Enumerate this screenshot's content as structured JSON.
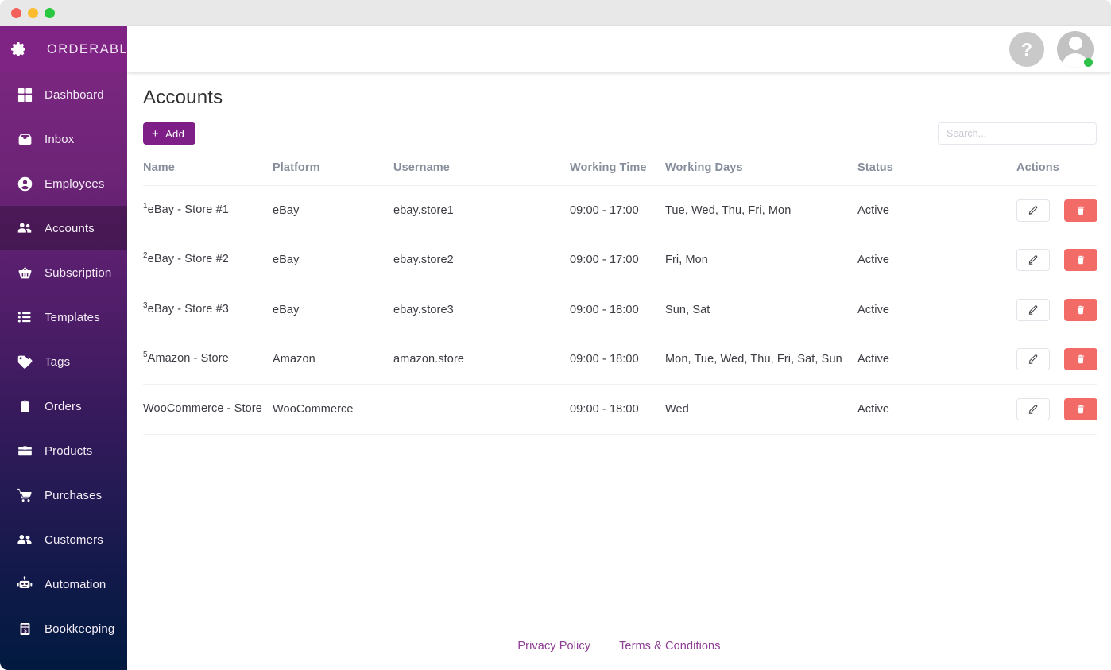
{
  "window": {
    "controls": [
      "close",
      "minimize",
      "maximize"
    ]
  },
  "brand": {
    "name": "ORDERABLY",
    "icon": "gear-icon"
  },
  "sidebar": {
    "items": [
      {
        "label": "Dashboard",
        "icon": "grid-icon",
        "active": false
      },
      {
        "label": "Inbox",
        "icon": "inbox-icon",
        "active": false
      },
      {
        "label": "Employees",
        "icon": "user-circle-icon",
        "active": false
      },
      {
        "label": "Accounts",
        "icon": "users-icon",
        "active": true
      },
      {
        "label": "Subscription",
        "icon": "basket-icon",
        "active": false
      },
      {
        "label": "Templates",
        "icon": "list-icon",
        "active": false
      },
      {
        "label": "Tags",
        "icon": "tag-icon",
        "active": false
      },
      {
        "label": "Orders",
        "icon": "clipboard-icon",
        "active": false
      },
      {
        "label": "Products",
        "icon": "box-icon",
        "active": false
      },
      {
        "label": "Purchases",
        "icon": "cart-icon",
        "active": false
      },
      {
        "label": "Customers",
        "icon": "people-icon",
        "active": false
      },
      {
        "label": "Automation",
        "icon": "robot-icon",
        "active": false
      },
      {
        "label": "Bookkeeping",
        "icon": "ledger-icon",
        "active": false
      }
    ]
  },
  "header": {
    "help_label": "?",
    "help_icon": "question-mark-icon",
    "avatar_icon": "avatar-icon",
    "status": "online"
  },
  "main": {
    "title": "Accounts",
    "add_button": {
      "label": "Add",
      "plus": "+"
    },
    "search": {
      "placeholder": "Search...",
      "value": ""
    },
    "table": {
      "columns": [
        "Name",
        "Platform",
        "Username",
        "Working Time",
        "Working Days",
        "Status",
        "Actions"
      ],
      "rows": [
        {
          "sup": "1",
          "name": "eBay - Store #1",
          "platform": "eBay",
          "username": "ebay.store1",
          "working_time": "09:00 - 17:00",
          "working_days": "Tue, Wed, Thu, Fri, Mon",
          "status": "Active",
          "rule": false
        },
        {
          "sup": "2",
          "name": "eBay - Store #2",
          "platform": "eBay",
          "username": "ebay.store2",
          "working_time": "09:00 - 17:00",
          "working_days": "Fri, Mon",
          "status": "Active",
          "rule": true
        },
        {
          "sup": "3",
          "name": "eBay - Store #3",
          "platform": "eBay",
          "username": "ebay.store3",
          "working_time": "09:00 - 18:00",
          "working_days": "Sun, Sat",
          "status": "Active",
          "rule": false
        },
        {
          "sup": "5",
          "name": "Amazon - Store",
          "platform": "Amazon",
          "username": "amazon.store",
          "working_time": "09:00 - 18:00",
          "working_days": "Mon, Tue, Wed, Thu, Fri, Sat, Sun",
          "status": "Active",
          "rule": true
        },
        {
          "sup": "",
          "name": "WooCommerce - Store",
          "platform": "WooCommerce",
          "username": "",
          "working_time": "09:00 - 18:00",
          "working_days": "Wed",
          "status": "Active",
          "rule": true
        }
      ],
      "edit_icon": "pencil-icon",
      "delete_icon": "trash-icon"
    }
  },
  "footer": {
    "links": [
      "Privacy Policy",
      "Terms & Conditions"
    ]
  },
  "colors": {
    "brand_purple": "#7e1f87",
    "sidebar_top": "#7a2681",
    "sidebar_bottom": "#021a3f",
    "delete_red": "#f26b67",
    "status_green": "#2fc24a",
    "link_purple": "#8d3d93",
    "table_header_gray": "#868e9b"
  }
}
